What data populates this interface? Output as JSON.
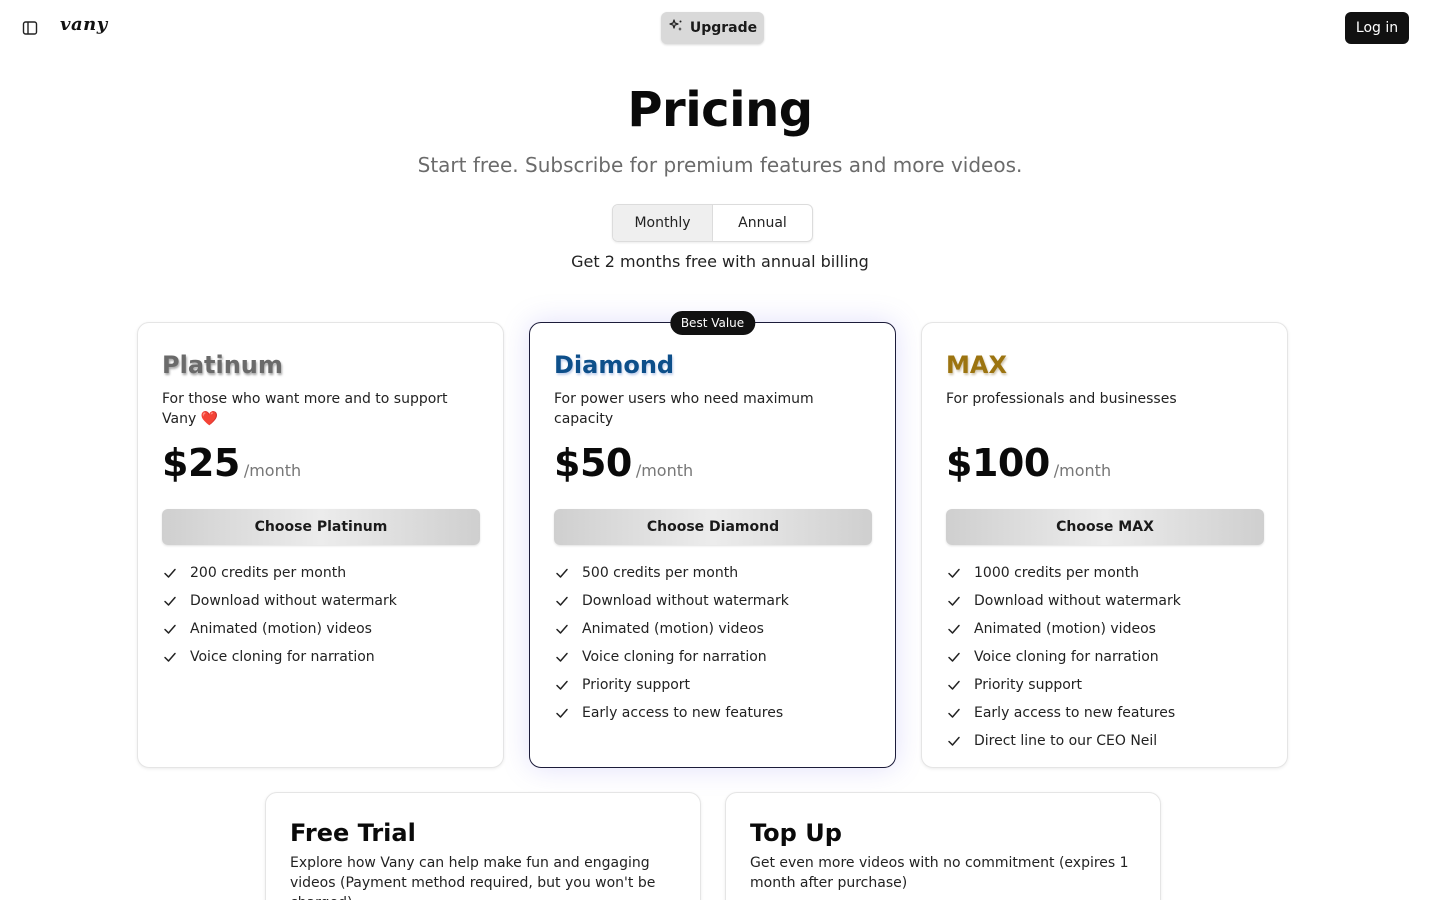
{
  "header": {
    "logo_text": "vany",
    "upgrade_label": "Upgrade",
    "login_label": "Log in"
  },
  "hero": {
    "title": "Pricing",
    "subtitle": "Start free. Subscribe for premium features and more videos.",
    "billing_options": [
      "Monthly",
      "Annual"
    ],
    "selected_billing": "Monthly",
    "annual_note": "Get 2 months free with annual billing"
  },
  "plans": [
    {
      "name": "Platinum",
      "description": "For those who want more and to support Vany ❤️",
      "price": "$25",
      "period": "/month",
      "button_label": "Choose Platinum",
      "features": [
        "200 credits per month",
        "Download without watermark",
        "Animated (motion) videos",
        "Voice cloning for narration"
      ]
    },
    {
      "name": "Diamond",
      "badge": "Best Value",
      "description": "For power users who need maximum capacity",
      "price": "$50",
      "period": "/month",
      "button_label": "Choose Diamond",
      "features": [
        "500 credits per month",
        "Download without watermark",
        "Animated (motion) videos",
        "Voice cloning for narration",
        "Priority support",
        "Early access to new features"
      ]
    },
    {
      "name": "MAX",
      "description": "For professionals and businesses",
      "price": "$100",
      "period": "/month",
      "button_label": "Choose MAX",
      "features": [
        "1000 credits per month",
        "Download without watermark",
        "Animated (motion) videos",
        "Voice cloning for narration",
        "Priority support",
        "Early access to new features",
        "Direct line to our CEO Neil"
      ]
    }
  ],
  "extras": [
    {
      "title": "Free Trial",
      "description": "Explore how Vany can help make fun and engaging videos (Payment method required, but you won't be charged)"
    },
    {
      "title": "Top Up",
      "description": "Get even more videos with no commitment (expires 1 month after purchase)"
    }
  ],
  "icons": {
    "sidebar_toggle": "sidebar-toggle-icon",
    "upgrade": "sparkles-icon",
    "feature_bullet": "check-icon"
  },
  "colors": {
    "platinum": "#6a6a6a",
    "diamond": "#0d4f8a",
    "max": "#9c7410",
    "login_bg": "#111111"
  }
}
